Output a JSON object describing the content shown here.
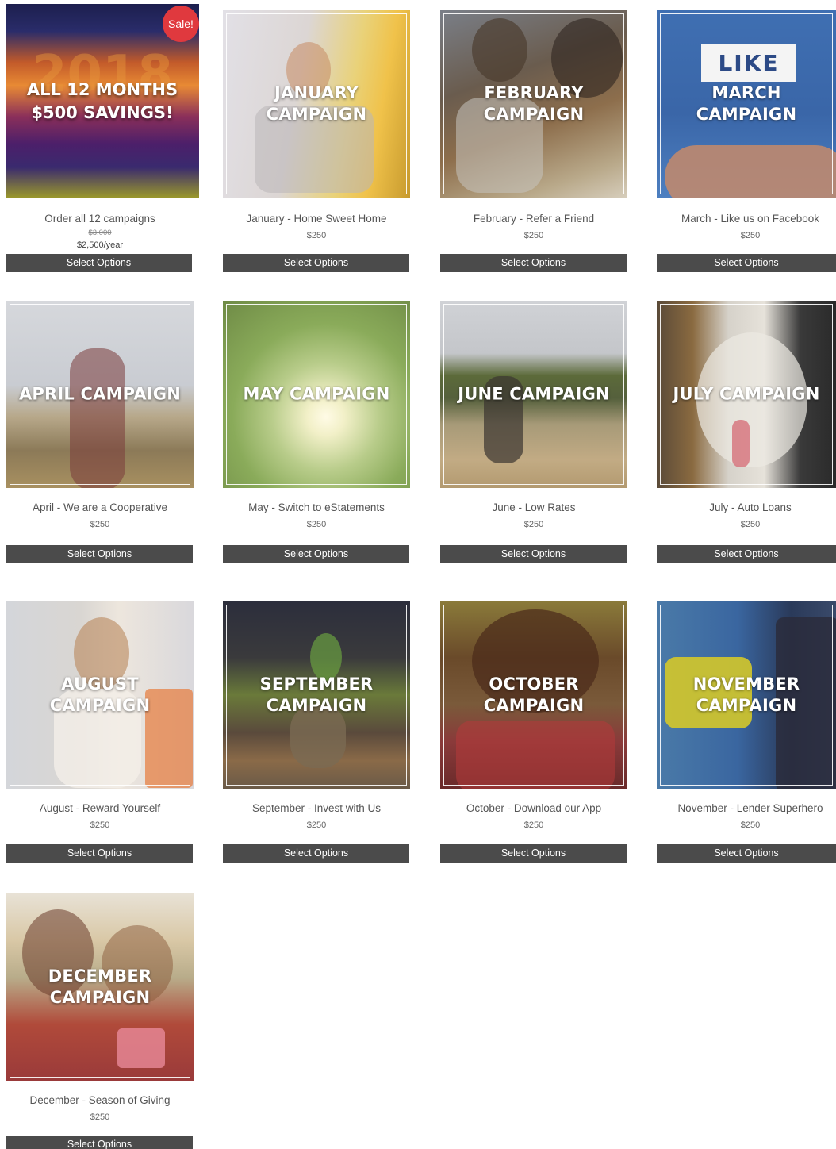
{
  "sale_badge": "Sale!",
  "bundle": {
    "overlay_line1": "ALL 12 MONTHS",
    "overlay_line2": "$500 SAVINGS!",
    "bg_year": "2018",
    "title": "Order all 12 campaigns",
    "old_price": "$3,000",
    "price": "$2,500/year",
    "button": "Select Options"
  },
  "products": [
    {
      "overlay": "JANUARY CAMPAIGN",
      "title": "January - Home Sweet Home",
      "price": "$250",
      "button": "Select Options"
    },
    {
      "overlay": "FEBRUARY CAMPAIGN",
      "title": "February - Refer a Friend",
      "price": "$250",
      "button": "Select Options"
    },
    {
      "overlay": "MARCH CAMPAIGN",
      "sign": "LIKE",
      "title": "March - Like us on Facebook",
      "price": "$250",
      "button": "Select Options"
    },
    {
      "overlay": "APRIL CAMPAIGN",
      "title": "April - We are a Cooperative",
      "price": "$250",
      "button": "Select Options"
    },
    {
      "overlay": "MAY CAMPAIGN",
      "title": "May - Switch to eStatements",
      "price": "$250",
      "button": "Select Options"
    },
    {
      "overlay": "JUNE CAMPAIGN",
      "title": "June - Low Rates",
      "price": "$250",
      "button": "Select Options"
    },
    {
      "overlay": "JULY CAMPAIGN",
      "title": "July - Auto Loans",
      "price": "$250",
      "button": "Select Options"
    },
    {
      "overlay": "AUGUST CAMPAIGN",
      "title": "August - Reward Yourself",
      "price": "$250",
      "button": "Select Options"
    },
    {
      "overlay": "SEPTEMBER CAMPAIGN",
      "title": "September -  Invest with Us",
      "price": "$250",
      "button": "Select Options"
    },
    {
      "overlay": "OCTOBER CAMPAIGN",
      "title": "October - Download our App",
      "price": "$250",
      "button": "Select Options"
    },
    {
      "overlay": "NOVEMBER CAMPAIGN",
      "title": "November -  Lender Superhero",
      "price": "$250",
      "button": "Select Options"
    },
    {
      "overlay": "DECEMBER CAMPAIGN",
      "title": "December - Season of Giving",
      "price": "$250",
      "button": "Select Options"
    }
  ],
  "colors": {
    "button_bg": "#4b4b4b",
    "sale_badge": "#e0393e",
    "title_text": "#555555"
  }
}
